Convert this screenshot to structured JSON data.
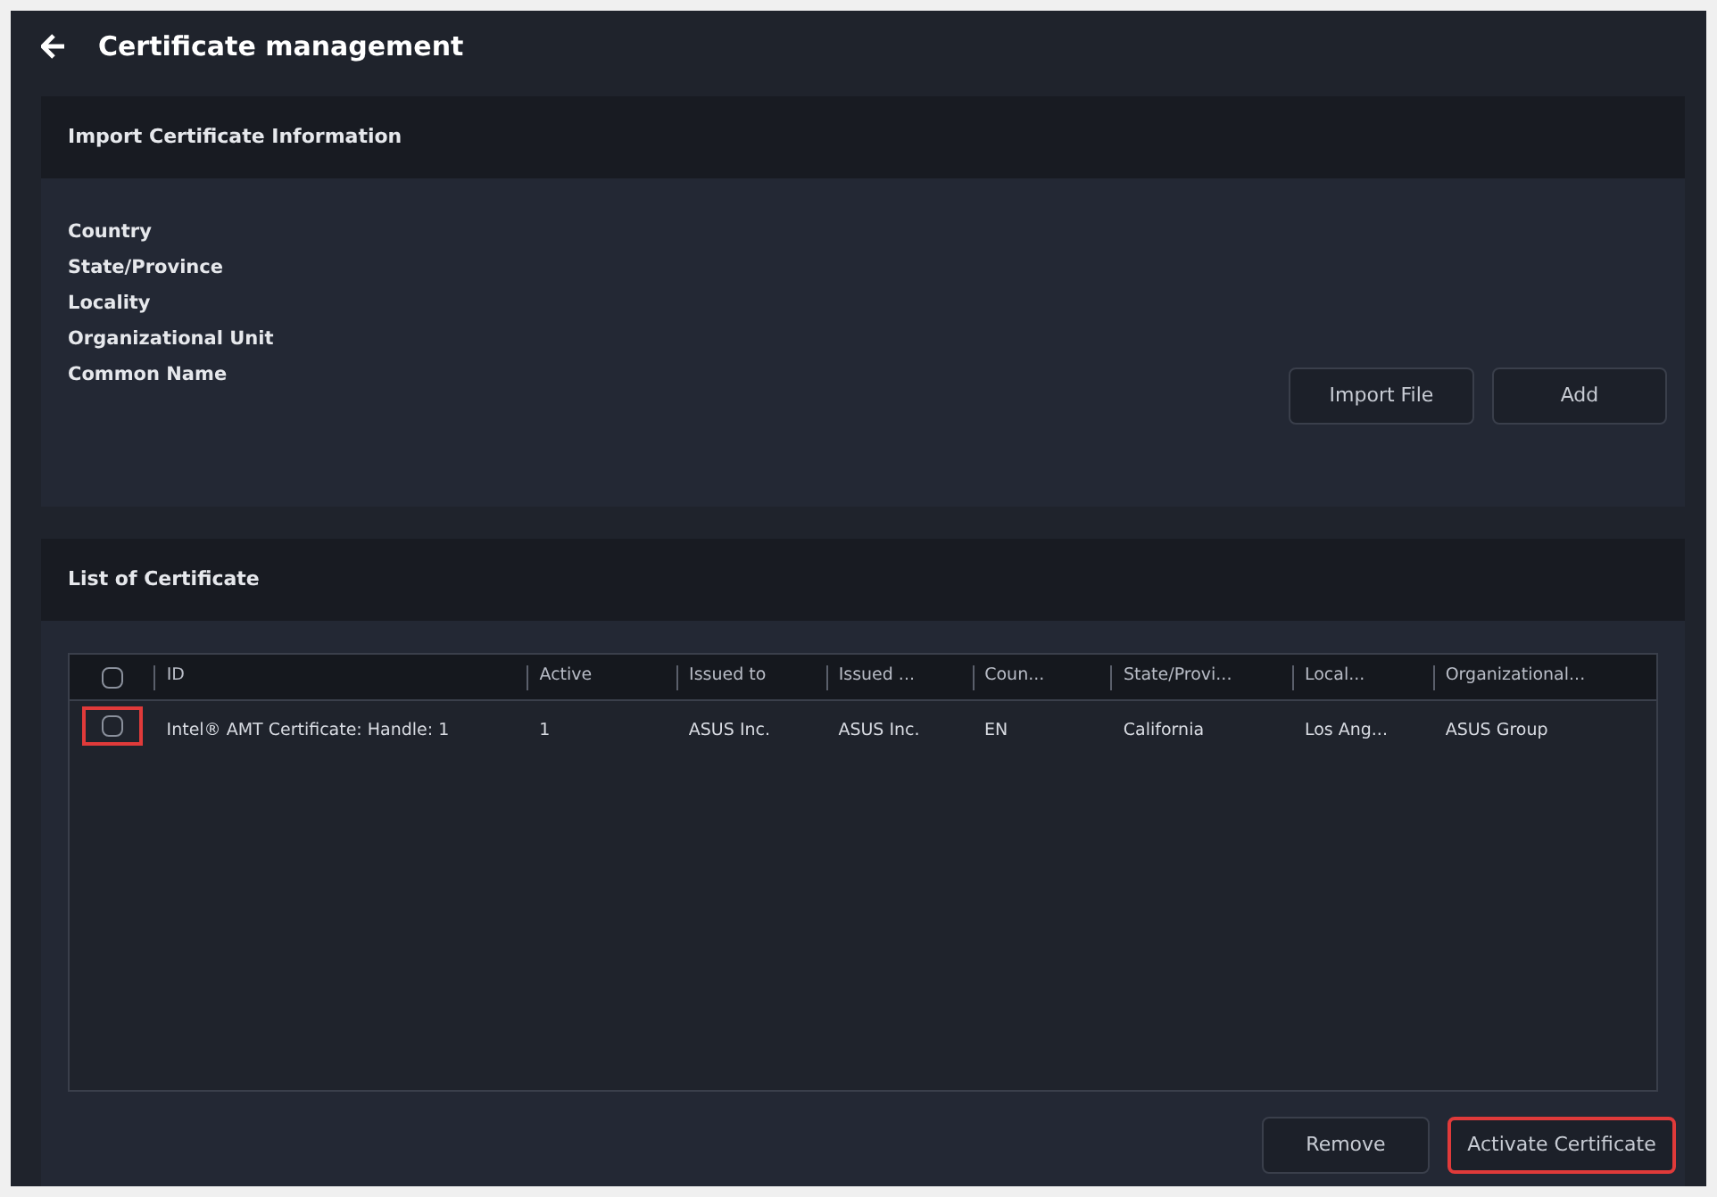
{
  "title": "Certificate management",
  "import_section": {
    "title": "Import Certificate Information",
    "fields": [
      "Country",
      "State/Province",
      "Locality",
      "Organizational Unit",
      "Common Name"
    ],
    "buttons": [
      {
        "label": "Import File",
        "highlighted": false
      },
      {
        "label": "Add",
        "highlighted": false
      }
    ]
  },
  "list_section": {
    "title": "List of Certificate",
    "table": {
      "header_checked": false,
      "columns": [
        "ID",
        "Active",
        "Issued to",
        "Issued ...",
        "Coun...",
        "State/Provi...",
        "Local...",
        "Organizational..."
      ],
      "rows": [
        {
          "checked": false,
          "highlighted": true,
          "cells": [
            "Intel® AMT Certificate: Handle: 1",
            "1",
            "ASUS Inc.",
            "ASUS Inc.",
            "EN",
            "California",
            "Los Ang...",
            "ASUS Group"
          ]
        }
      ]
    },
    "buttons": [
      {
        "label": "Remove",
        "highlighted": false
      },
      {
        "label": "Activate Certificate",
        "highlighted": true
      }
    ]
  }
}
